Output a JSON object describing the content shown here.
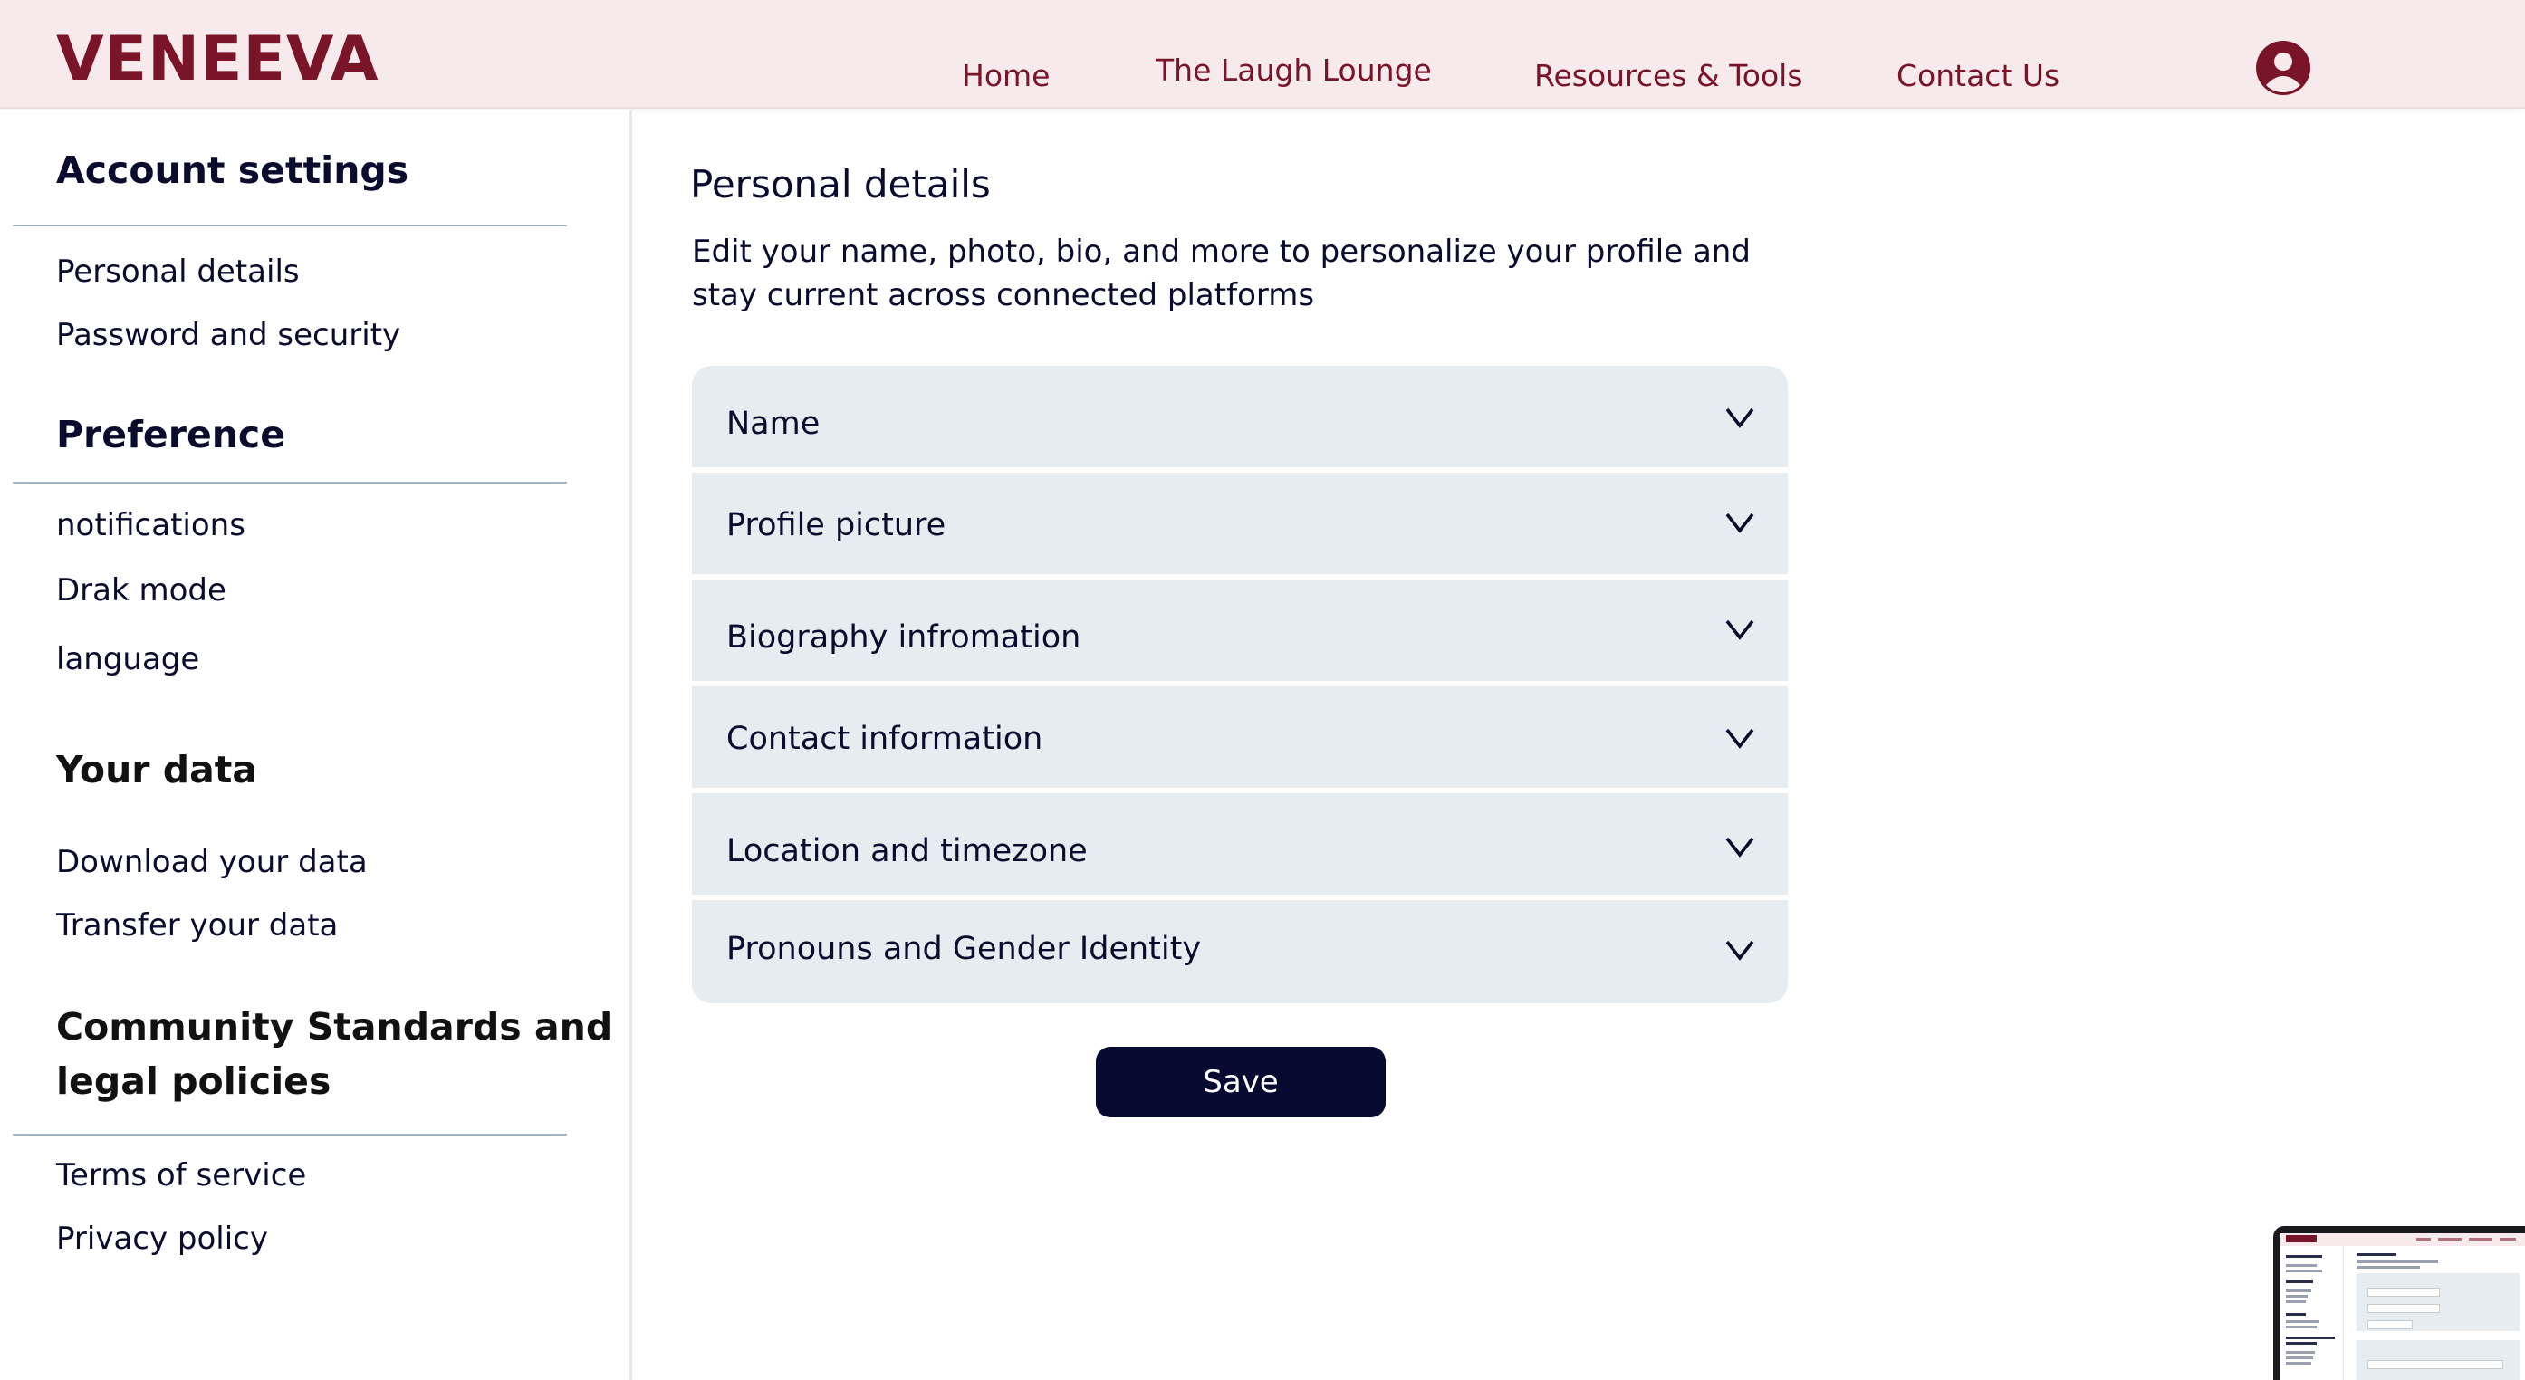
{
  "header": {
    "logo": "VENEEVA",
    "nav": [
      "Home",
      "The Laugh Lounge",
      "Resources & Tools",
      "Contact Us"
    ],
    "profile_icon": "user-circle-icon"
  },
  "sidebar": {
    "sections": [
      {
        "title": "Account settings",
        "items": [
          "Personal details",
          "Password and security"
        ]
      },
      {
        "title": "Preference",
        "items": [
          "notifications",
          "Drak mode",
          "language"
        ]
      },
      {
        "title": "Your data",
        "items": [
          "Download your data",
          "Transfer your data"
        ]
      },
      {
        "title_line1": "Community Standards and",
        "title_line2": "legal policies",
        "items": [
          "Terms of service",
          "Privacy policy"
        ]
      }
    ]
  },
  "main": {
    "title": "Personal details",
    "description": "Edit your name, photo, bio, and more to personalize your profile and stay current across connected platforms",
    "sections": [
      "Name",
      "Profile picture",
      "Biography infromation",
      "Contact information",
      "Location and timezone",
      "Pronouns and Gender Identity"
    ],
    "save_label": "Save"
  },
  "colors": {
    "brand": "#7a1428",
    "header_bg": "#f6eaec",
    "panel_bg": "#e6ecf0",
    "button_bg": "#070a30",
    "divider": "#9eb4c6"
  }
}
